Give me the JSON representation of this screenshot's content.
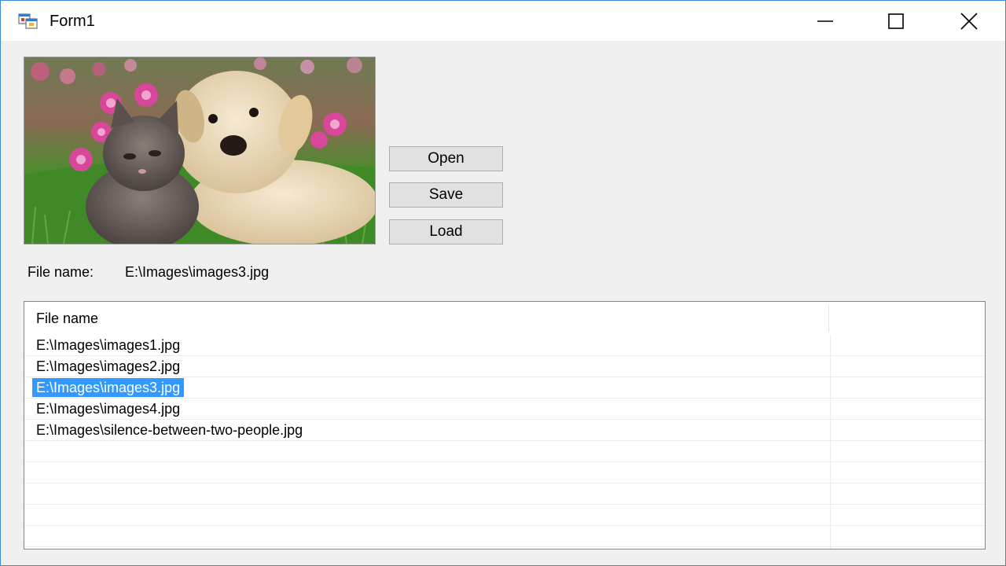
{
  "window": {
    "title": "Form1"
  },
  "buttons": {
    "open": "Open",
    "save": "Save",
    "load": "Load"
  },
  "file_label": "File name:",
  "file_value": "E:\\Images\\images3.jpg",
  "listview": {
    "column_header": "File name",
    "selected_index": 2,
    "rows": [
      "E:\\Images\\images1.jpg",
      "E:\\Images\\images2.jpg",
      "E:\\Images\\images3.jpg",
      "E:\\Images\\images4.jpg",
      "E:\\Images\\silence-between-two-people.jpg",
      "",
      "",
      "",
      "",
      ""
    ]
  },
  "colors": {
    "selection": "#3399ff",
    "window_bg": "#f0f0f0",
    "button_bg": "#e1e1e1"
  },
  "picture": {
    "subject": "puppy and kitten on grass with pink flowers"
  }
}
